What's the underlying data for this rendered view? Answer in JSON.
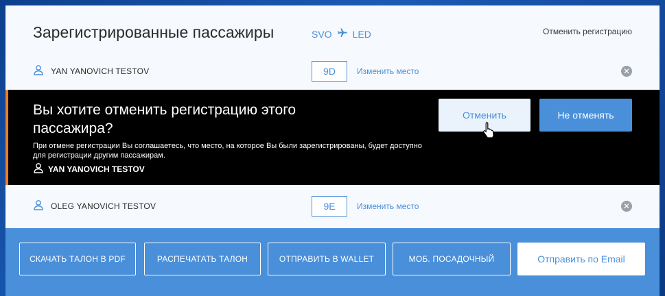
{
  "header": {
    "title": "Зарегистрированные пассажиры",
    "route_from": "SVO",
    "route_to": "LED",
    "cancel_link": "Отменить регистрацию"
  },
  "passengers": [
    {
      "name": "YAN YANOVICH TESTOV",
      "seat": "9D",
      "change_seat": "Изменить место"
    },
    {
      "name": "OLEG YANOVICH TESTOV",
      "seat": "9E",
      "change_seat": "Изменить место"
    }
  ],
  "confirm": {
    "question": "Вы хотите отменить регистрацию этого пассажира?",
    "description": "При отмене регистрации Вы соглашаетесь, что место, на которое Вы были зарегистрированы, будет доступно для регистрации другим пассажирам.",
    "passenger": "YAN YANOVICH TESTOV",
    "yes_label": "Отменить",
    "no_label": "Не отменять"
  },
  "actions": {
    "pdf": "СКАЧАТЬ ТАЛОН В PDF",
    "print": "РАСПЕЧАТАТЬ ТАЛОН",
    "wallet": "ОТПРАВИТЬ В WALLET",
    "mobile": "МОБ. ПОСАДОЧНЫЙ",
    "email": "Отправить по Email"
  },
  "colors": {
    "accent": "#4a8fd9",
    "warning_border": "#f07c1f",
    "dialog_bg": "#000000"
  }
}
